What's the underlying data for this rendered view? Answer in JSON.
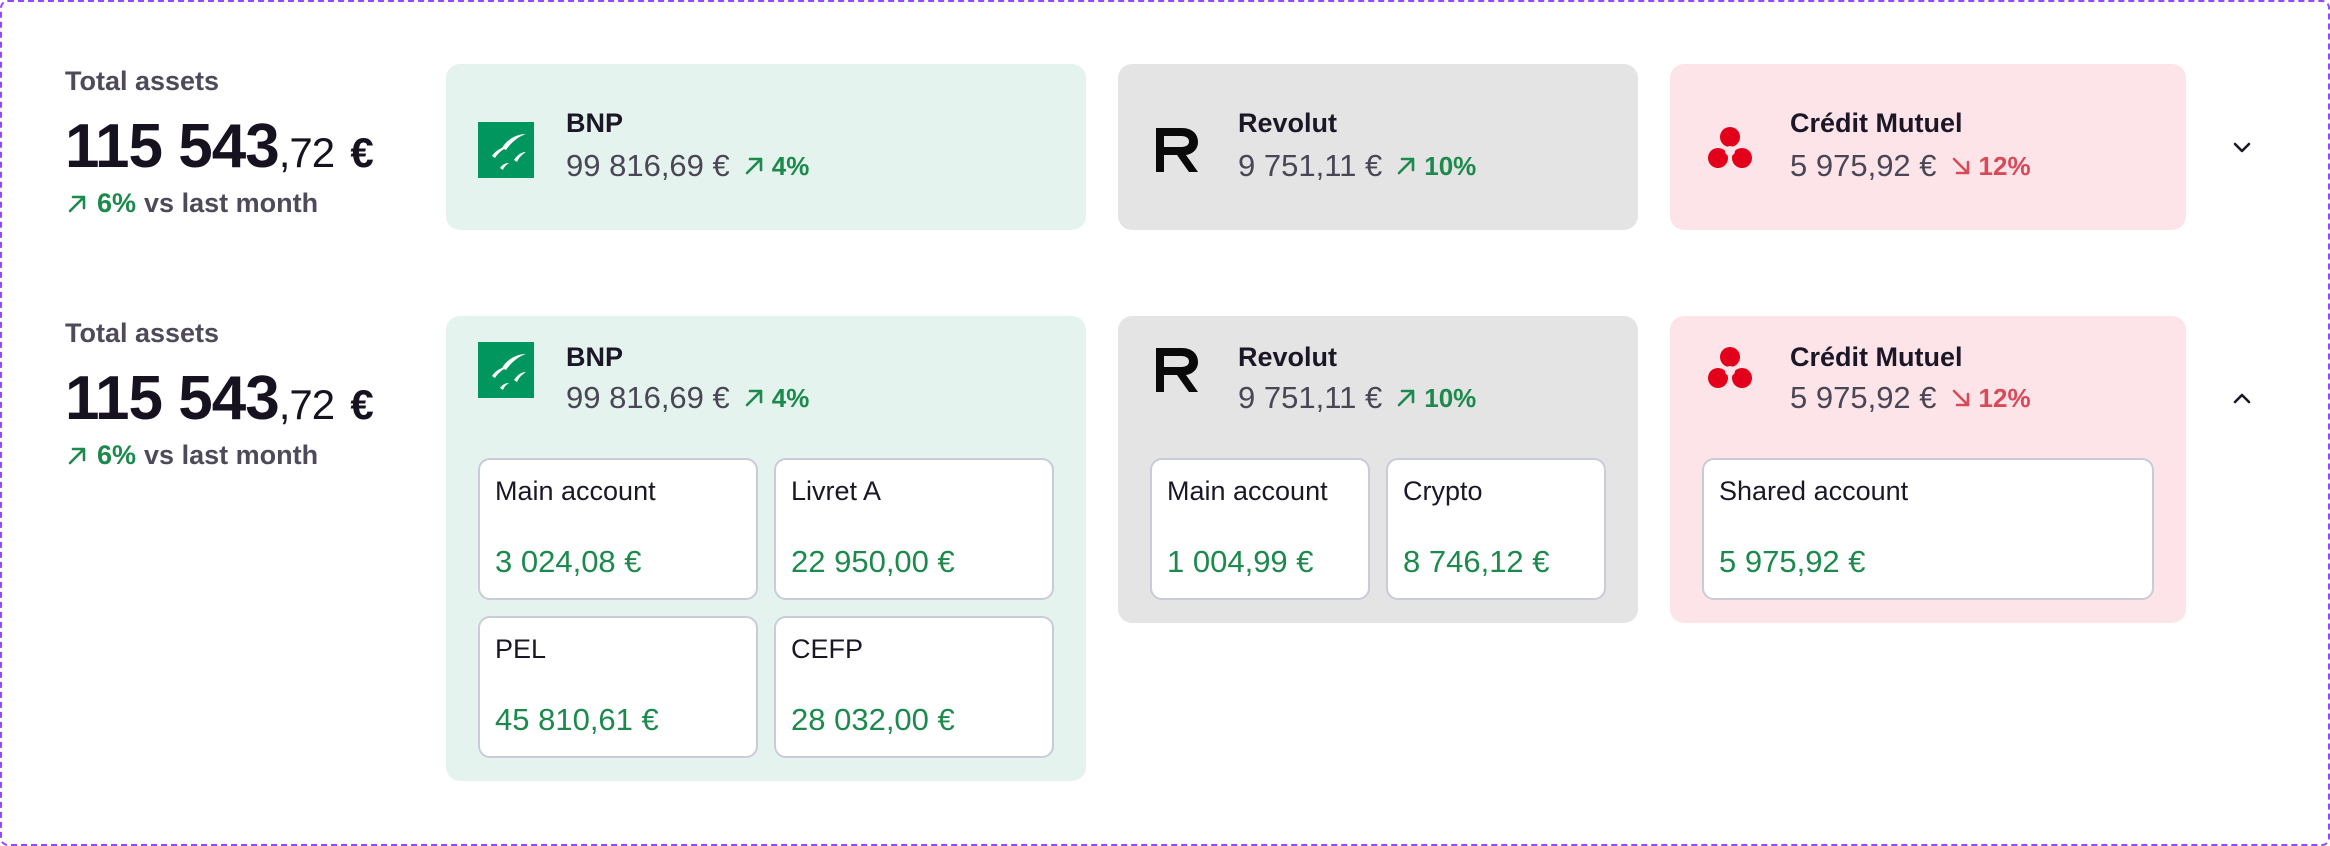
{
  "colors": {
    "frame_border": "#9747ff",
    "bnp_bg": "#e4f3ed",
    "revolut_bg": "#e4e4e4",
    "credit_mutuel_bg": "#fce4e8",
    "positive": "#1c8a4c",
    "negative": "#d94a58",
    "bnp_brand": "#00965e",
    "credit_mutuel_brand": "#e2001a"
  },
  "collapsed": {
    "total": {
      "label": "Total assets",
      "amount_int": "115 543",
      "amount_dec": ",72",
      "currency": "€",
      "trend_pct": "6%",
      "trend_text": "vs last month",
      "trend_direction": "up"
    },
    "banks": [
      {
        "name": "BNP",
        "balance": "99 816,69 €",
        "pct": "4%",
        "direction": "up",
        "icon": "bnp-logo-icon"
      },
      {
        "name": "Revolut",
        "balance": "9 751,11 €",
        "pct": "10%",
        "direction": "up",
        "icon": "revolut-logo-icon"
      },
      {
        "name": "Crédit Mutuel",
        "balance": "5 975,92 €",
        "pct": "12%",
        "direction": "down",
        "icon": "credit-mutuel-logo-icon"
      }
    ],
    "toggle_icon": "chevron-down-icon"
  },
  "expanded": {
    "total": {
      "label": "Total assets",
      "amount_int": "115 543",
      "amount_dec": ",72",
      "currency": "€",
      "trend_pct": "6%",
      "trend_text": "vs last month",
      "trend_direction": "up"
    },
    "banks": [
      {
        "name": "BNP",
        "balance": "99 816,69 €",
        "pct": "4%",
        "direction": "up",
        "accounts": [
          {
            "name": "Main account",
            "value": "3 024,08 €"
          },
          {
            "name": "Livret A",
            "value": "22 950,00 €"
          },
          {
            "name": "PEL",
            "value": "45 810,61 €"
          },
          {
            "name": "CEFP",
            "value": "28 032,00 €"
          }
        ]
      },
      {
        "name": "Revolut",
        "balance": "9 751,11 €",
        "pct": "10%",
        "direction": "up",
        "accounts": [
          {
            "name": "Main account",
            "value": "1 004,99 €"
          },
          {
            "name": "Crypto",
            "value": "8 746,12 €"
          }
        ]
      },
      {
        "name": "Crédit Mutuel",
        "balance": "5 975,92 €",
        "pct": "12%",
        "direction": "down",
        "accounts": [
          {
            "name": "Shared account",
            "value": "5 975,92 €"
          }
        ]
      }
    ],
    "toggle_icon": "chevron-up-icon"
  }
}
